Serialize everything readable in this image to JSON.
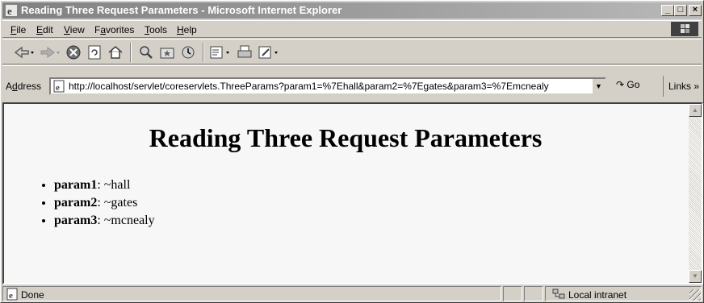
{
  "window": {
    "title": "Reading Three Request Parameters - Microsoft Internet Explorer"
  },
  "menu": [
    {
      "label": "File",
      "u": "F",
      "rest": "ile"
    },
    {
      "label": "Edit",
      "u": "E",
      "rest": "dit"
    },
    {
      "label": "View",
      "u": "V",
      "rest": "iew"
    },
    {
      "label": "Favorites",
      "u": "a",
      "pre": "F",
      "rest": "vorites"
    },
    {
      "label": "Tools",
      "u": "T",
      "rest": "ools"
    },
    {
      "label": "Help",
      "u": "H",
      "rest": "elp"
    }
  ],
  "toolbar": {
    "icons": [
      "back-icon",
      "forward-icon",
      "stop-icon",
      "refresh-icon",
      "home-icon",
      "search-icon",
      "favorites-icon",
      "history-icon",
      "mail-icon",
      "print-icon",
      "edit-icon"
    ]
  },
  "address": {
    "label": "Address",
    "label_u": "d",
    "url": "http://localhost/servlet/coreservlets.ThreeParams?param1=%7Ehall&param2=%7Egates&param3=%7Emcnealy",
    "go": "Go",
    "links": "Links »"
  },
  "page": {
    "heading": "Reading Three Request Parameters",
    "params": [
      {
        "name": "param1",
        "value": ": ~hall"
      },
      {
        "name": "param2",
        "value": ": ~gates"
      },
      {
        "name": "param3",
        "value": ": ~mcnealy"
      }
    ]
  },
  "status": {
    "text": "Done",
    "zone": "Local intranet"
  }
}
